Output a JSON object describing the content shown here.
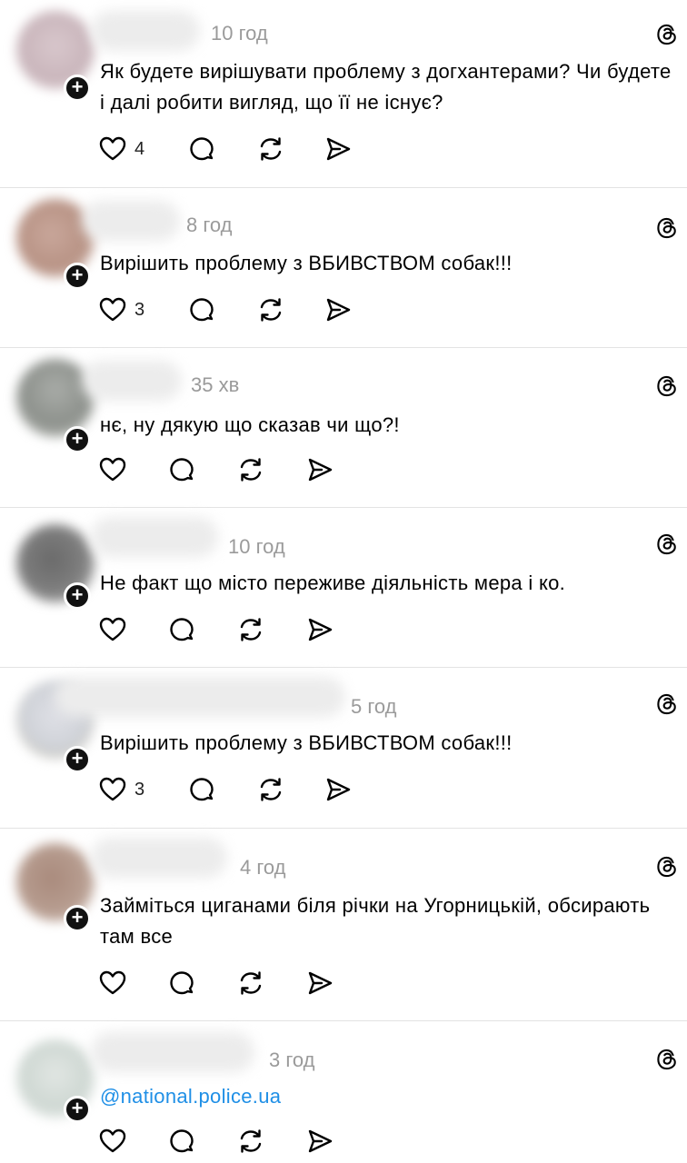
{
  "posts": [
    {
      "time": "10 год",
      "text": "Як будете вирішувати проблему з догхантерами? Чи будете і далі робити вигляд, що її не існує?",
      "likes": "4"
    },
    {
      "time": "8 год",
      "text": "Вирішить проблему з ВБИВСТВОМ собак!!!",
      "likes": "3"
    },
    {
      "time": "35 хв",
      "text": "нє, ну дякую що сказав чи що?!",
      "likes": ""
    },
    {
      "time": "10 год",
      "text": "Не факт що місто переживе діяльність мера і ко.",
      "likes": ""
    },
    {
      "time": "5 год",
      "text": "Вирішить проблему з ВБИВСТВОМ собак!!!",
      "likes": "3"
    },
    {
      "time": "4 год",
      "text": "Займіться циганами біля річки на Угорницькій, обсирають там все",
      "likes": ""
    },
    {
      "time": "3 год",
      "text": "@national.police.ua",
      "likes": ""
    }
  ],
  "icons": {
    "app_logo": "threads-logo-icon",
    "like": "heart-icon",
    "reply": "comment-icon",
    "repost": "repost-icon",
    "share": "send-icon"
  },
  "colors": {
    "mention": "#1f8fe6",
    "timestamp": "#9a9a9a",
    "divider": "#e3e3e3"
  }
}
